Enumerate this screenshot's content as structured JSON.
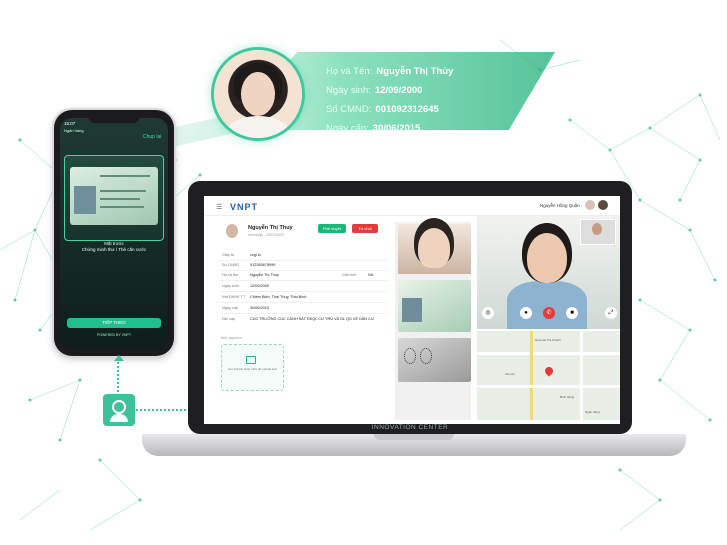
{
  "identity": {
    "name_label": "Họ và Tên:",
    "name_value": "Nguyễn Thị Thủy",
    "dob_label": "Ngày sinh:",
    "dob_value": "12/09/2000",
    "id_label": "Số CMND:",
    "id_value": "001092312645",
    "issue_label": "Ngày cấp:",
    "issue_value": "30/06/2015"
  },
  "phone": {
    "status_time": "15:07",
    "ticker": "Ngân hàng",
    "close": "Chụp lại",
    "step_line1": "Mặt trước",
    "step_line2": "Chứng minh thư / Thẻ căn cước",
    "button": "TIẾP THEO",
    "footer": "POWERED BY VNPT"
  },
  "app": {
    "logo": "VNPT",
    "user_name": "Nguyễn Hồng Quân",
    "profile_name": "Nguyễn Thị Thuỷ",
    "profile_sub": "dd/mm/yy - 12/07/2019",
    "approve": "Phê duyệt",
    "reject": "Từ chối",
    "fields": [
      {
        "label": "Giấy tờ",
        "value": "vcgi ki"
      },
      {
        "label": "Số CMND",
        "value": "012345678999"
      },
      {
        "label": "Họ và tên",
        "value": "Nguyễn Thị Thuỷ"
      },
      {
        "label": "Ngày sinh",
        "value": "12/09/2000"
      },
      {
        "label": "Nơi ĐKHK TT",
        "value": "Chiềm Biên, Thái Thụy, Thái Bình"
      },
      {
        "label": "Ngày cấp",
        "value": "30/06/2015"
      },
      {
        "label": "Nơi cấp",
        "value": "CỤC TRƯỞNG CỤC CẢNH SÁT ĐKQL CƯ TRÚ VÀ DL QG VỀ DÂN CƯ"
      }
    ],
    "gender_label": "Giới tính",
    "gender_value": "Nữ",
    "attachment_label": "Ảnh captures",
    "upload_text": "Kéo thả file hoặc click để upload ảnh"
  },
  "laptop": {
    "brand": "INNOVATION CENTER"
  },
  "map": {
    "labels": [
      "Hoa Cat Trà Chanh",
      "Cà Lợn",
      "Bình Hồng",
      "Ngân hàng"
    ]
  },
  "colors": {
    "accent": "#3cc29a",
    "approve": "#1db679",
    "reject": "#e53a3a",
    "brand_blue": "#1f5fb4"
  }
}
